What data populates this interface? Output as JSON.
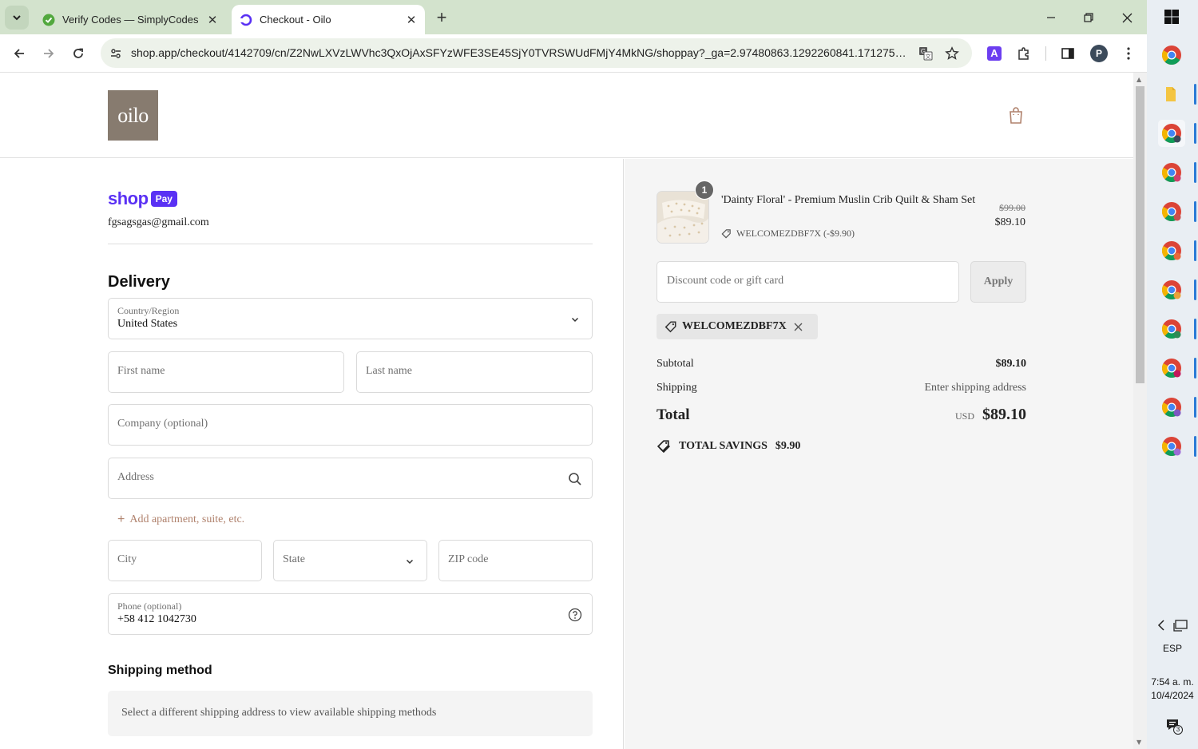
{
  "browser": {
    "tabs": [
      {
        "title": "Verify Codes — SimplyCodes",
        "active": false
      },
      {
        "title": "Checkout - Oilo",
        "active": true
      }
    ],
    "url": "shop.app/checkout/4142709/cn/Z2NwLXVzLWVhc3QxOjAxSFYzWFE3SE45SjY0TVRSWUdFMjY4MkNG/shoppay?_ga=2.97480863.1292260841.1712750...",
    "profile_initial": "P",
    "extension_letter": "A",
    "accent_color": "#d3e3cd"
  },
  "header": {
    "logo_text": "oilo",
    "logo_color": "#877b6f"
  },
  "shop_pay": {
    "brand_word": "shop",
    "pill_text": "Pay",
    "brand_color": "#5a31f4",
    "email": "fgsagsgas@gmail.com"
  },
  "delivery": {
    "title": "Delivery",
    "country_label": "Country/Region",
    "country_value": "United States",
    "first_name_placeholder": "First name",
    "last_name_placeholder": "Last name",
    "company_placeholder": "Company (optional)",
    "address_placeholder": "Address",
    "add_apartment": "Add apartment, suite, etc.",
    "city_placeholder": "City",
    "state_placeholder": "State",
    "zip_placeholder": "ZIP code",
    "phone_label": "Phone (optional)",
    "phone_value": "+58 412 1042730"
  },
  "shipping_method": {
    "title": "Shipping method",
    "notice": "Select a different shipping address to view available shipping methods"
  },
  "order": {
    "quantity": "1",
    "product_name": "'Dainty Floral' - Premium Muslin Crib Quilt & Sham Set",
    "discount_line": "WELCOMEZDBF7X (-$9.90)",
    "price_original": "$99.00",
    "price_final": "$89.10",
    "discount_placeholder": "Discount code or gift card",
    "apply_label": "Apply",
    "applied_code": "WELCOMEZDBF7X",
    "subtotal_label": "Subtotal",
    "subtotal_value": "$89.10",
    "shipping_label": "Shipping",
    "shipping_value": "Enter shipping address",
    "total_label": "Total",
    "total_currency": "USD",
    "total_value": "$89.10",
    "savings_label": "TOTAL SAVINGS",
    "savings_value": "$9.90"
  },
  "taskbar": {
    "language": "ESP",
    "time": "7:54 a. m.",
    "date": "10/4/2024",
    "notification_count": "3"
  }
}
